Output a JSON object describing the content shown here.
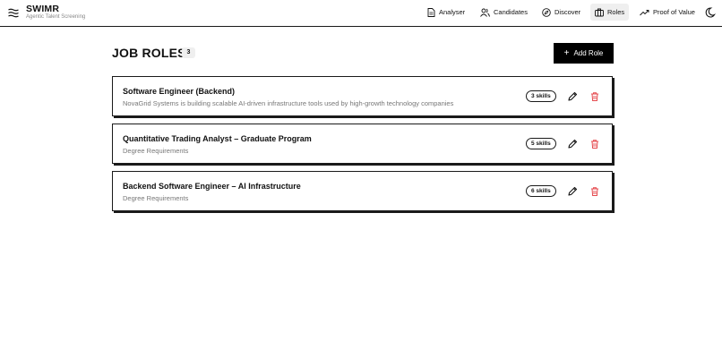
{
  "brand": {
    "name": "SWIMR",
    "tagline": "Agentic Talent Screening"
  },
  "nav": {
    "items": [
      {
        "label": "Analyser",
        "icon": "document-icon"
      },
      {
        "label": "Candidates",
        "icon": "users-icon"
      },
      {
        "label": "Discover",
        "icon": "compass-icon"
      },
      {
        "label": "Roles",
        "icon": "briefcase-icon",
        "active": true
      },
      {
        "label": "Proof of Value",
        "icon": "trending-up-icon"
      }
    ],
    "theme_icon": "moon-icon"
  },
  "main": {
    "title": "JOB ROLES",
    "count": "3",
    "add_label": "Add Role",
    "roles": [
      {
        "title": "Software Engineer (Backend)",
        "description": "NovaGrid Systems is building scalable AI-driven infrastructure tools used by high-growth technology companies",
        "skills": "3 skills"
      },
      {
        "title": "Quantitative Trading Analyst – Graduate Program",
        "description": "Degree Requirements",
        "skills": "5 skills"
      },
      {
        "title": "Backend Software Engineer – AI Infrastructure",
        "description": "Degree Requirements",
        "skills": "6 skills"
      }
    ]
  },
  "colors": {
    "accent": "#000000",
    "border": "#1a1a1a",
    "delete": "#e5484d",
    "muted_text": "#777777",
    "active_nav_bg": "#efefef"
  }
}
